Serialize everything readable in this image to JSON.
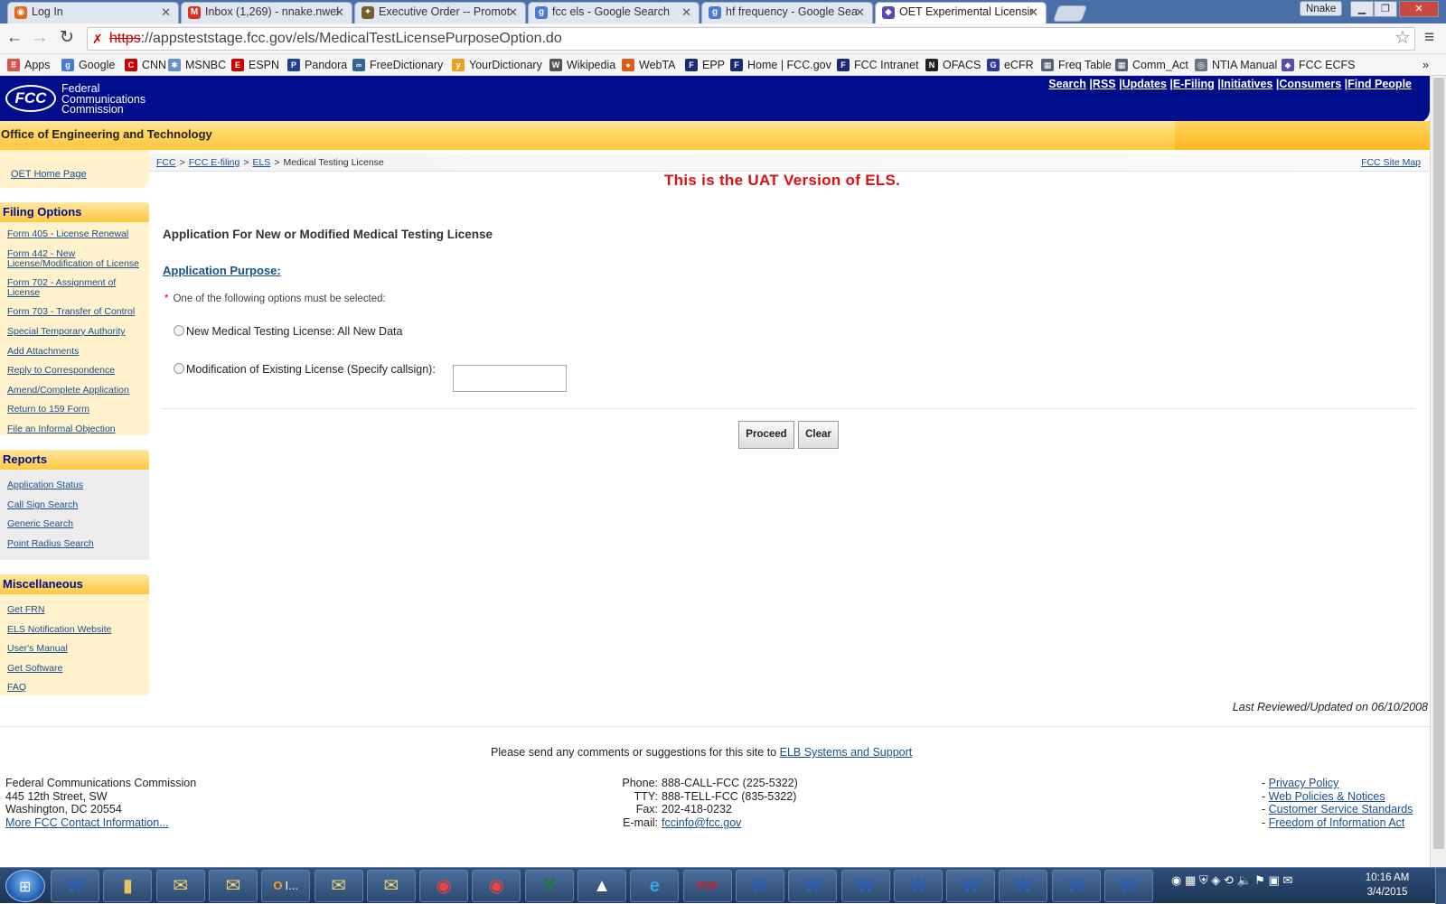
{
  "browser": {
    "tabs": [
      {
        "title": "Log In",
        "favicon": "firefox-icon",
        "color": "#e06a1a",
        "glyph": "◉"
      },
      {
        "title": "Inbox (1,269) - nnake.nwel",
        "favicon": "gmail-icon",
        "color": "#d93025",
        "glyph": "M"
      },
      {
        "title": "Executive Order -- Promot",
        "favicon": "whitehouse-seal-icon",
        "color": "#7a5c2e",
        "glyph": "✦"
      },
      {
        "title": "fcc els - Google Search",
        "favicon": "google-icon",
        "color": "#4a7bd8",
        "glyph": "g"
      },
      {
        "title": "hf frequency - Google Sea",
        "favicon": "google-icon",
        "color": "#4a7bd8",
        "glyph": "g"
      },
      {
        "title": "OET Experimental Licensir",
        "favicon": "fcc-diamond-icon",
        "color": "#5a4ab8",
        "glyph": "◆"
      }
    ],
    "profile_name": "Nnake",
    "url_scheme": "https",
    "url_rest": "://appsteststage.fcc.gov/els/MedicalTestLicensePurposeOption.do",
    "bookmarks": [
      {
        "label": "Apps",
        "icon": "apps-grid-icon",
        "color": "#d9534f",
        "glyph": "⠿"
      },
      {
        "label": "Google",
        "icon": "google-icon",
        "color": "#4a7bd8",
        "glyph": "g"
      },
      {
        "label": "CNN",
        "icon": "cnn-icon",
        "color": "#cc0000",
        "glyph": "C"
      },
      {
        "label": "MSNBC",
        "icon": "msnbc-icon",
        "color": "#6a8fd0",
        "glyph": "✱"
      },
      {
        "label": "ESPN",
        "icon": "espn-icon",
        "color": "#cc0000",
        "glyph": "E"
      },
      {
        "label": "Pandora",
        "icon": "pandora-icon",
        "color": "#224099",
        "glyph": "P"
      },
      {
        "label": "FreeDictionary",
        "icon": "freedictionary-icon",
        "color": "#336699",
        "glyph": "∞"
      },
      {
        "label": "YourDictionary",
        "icon": "yourdictionary-icon",
        "color": "#f0a020",
        "glyph": "y"
      },
      {
        "label": "Wikipedia",
        "icon": "wikipedia-icon",
        "color": "#555555",
        "glyph": "W"
      },
      {
        "label": "WebTA",
        "icon": "webta-icon",
        "color": "#e05a1a",
        "glyph": "●"
      },
      {
        "label": "EPP",
        "icon": "epp-icon",
        "color": "#1a2a7a",
        "glyph": "F"
      },
      {
        "label": "Home | FCC.gov",
        "icon": "fcc-icon",
        "color": "#1a2a7a",
        "glyph": "F"
      },
      {
        "label": "FCC Intranet",
        "icon": "fcc-icon",
        "color": "#1a2a7a",
        "glyph": "F"
      },
      {
        "label": "OFACS",
        "icon": "ofacs-icon",
        "color": "#222222",
        "glyph": "N"
      },
      {
        "label": "eCFR",
        "icon": "gpo-icon",
        "color": "#2a3aa0",
        "glyph": "G"
      },
      {
        "label": "Freq Table",
        "icon": "freq-table-icon",
        "color": "#556677",
        "glyph": "▦"
      },
      {
        "label": "Comm_Act",
        "icon": "comm-act-icon",
        "color": "#556677",
        "glyph": "▦"
      },
      {
        "label": "NTIA Manual",
        "icon": "ntia-icon",
        "color": "#667788",
        "glyph": "◎"
      },
      {
        "label": "FCC ECFS",
        "icon": "fcc-diamond-icon",
        "color": "#5a4ab8",
        "glyph": "◆"
      }
    ],
    "bookmarks_overflow": "»"
  },
  "site": {
    "logo_text": "FCC",
    "agency_name": [
      "Federal",
      "Communications",
      "Commission"
    ],
    "header_links": [
      "Search",
      "RSS",
      "Updates",
      "E-Filing",
      "Initiatives",
      "Consumers",
      "Find People"
    ],
    "office_title": "Office of Engineering and Technology",
    "oet_home_link": "OET Home Page",
    "site_map_link": "FCC Site Map",
    "breadcrumb": [
      {
        "label": "FCC",
        "link": true
      },
      {
        "label": "FCC E-filing",
        "link": true
      },
      {
        "label": "ELS",
        "link": true
      },
      {
        "label": "Medical Testing License",
        "link": false
      }
    ],
    "breadcrumb_sep": ">",
    "uat_notice": "This is the UAT Version of ELS."
  },
  "sidebar": {
    "filing_options_title": "Filing Options",
    "filing_options": [
      "Form 405 - License Renewal",
      "Form 442 - New License/Modification of License",
      "Form 702 - Assignment of License",
      "Form 703 - Transfer of Control",
      "Special Temporary Authority",
      "Add Attachments",
      "Reply to Correspondence",
      "Amend/Complete Application",
      "Return to 159 Form",
      "File an Informal Objection"
    ],
    "reports_title": "Reports",
    "reports": [
      "Application Status",
      "Call Sign Search",
      "Generic Search",
      "Point Radius Search"
    ],
    "misc_title": "Miscellaneous",
    "misc": [
      "Get FRN",
      "ELS Notification Website",
      "User's Manual",
      "Get Software",
      "FAQ"
    ]
  },
  "form": {
    "title": "Application For New or Modified Medical Testing License",
    "purpose_label": "Application Purpose:",
    "required_star": "*",
    "required_note": "One of the following options must be selected:",
    "option_new": "New Medical Testing License: All New Data",
    "option_new_selected": false,
    "option_modify": "Modification of Existing License (Specify callsign):",
    "option_modify_selected": false,
    "callsign_value": "",
    "proceed_label": "Proceed",
    "clear_label": "Clear"
  },
  "footer": {
    "last_reviewed": "Last Reviewed/Updated on 06/10/2008",
    "comments_text": "Please send any comments or suggestions for this site to",
    "comments_link": "ELB Systems and Support",
    "address": [
      "Federal Communications Commission",
      "445 12th Street, SW",
      "Washington, DC 20554"
    ],
    "more_contact": "More FCC Contact Information...",
    "contact_rows": [
      {
        "label": "Phone:",
        "value": "888-CALL-FCC (225-5322)"
      },
      {
        "label": "TTY:",
        "value": "888-TELL-FCC (835-5322)"
      },
      {
        "label": "Fax:",
        "value": "202-418-0232"
      },
      {
        "label": "E-mail:",
        "value": "fccinfo@fcc.gov"
      }
    ],
    "policy_links": [
      "Privacy Policy",
      "Web Policies & Notices",
      "Customer Service Standards",
      "Freedom of Information Act"
    ]
  },
  "taskbar": {
    "apps": [
      {
        "name": "word-icon",
        "glyph": "W",
        "color": "#2b5fb4"
      },
      {
        "name": "explorer-folder-icon",
        "glyph": "▮",
        "color": "#e8c25a"
      },
      {
        "name": "mail-icon",
        "glyph": "✉",
        "color": "#f2d36b"
      },
      {
        "name": "mail-icon",
        "glyph": "✉",
        "color": "#f2d36b"
      },
      {
        "name": "outlook-icon",
        "glyph": "O",
        "color": "#f0a020"
      },
      {
        "name": "mail-icon",
        "glyph": "✉",
        "color": "#f2d36b"
      },
      {
        "name": "mail-icon",
        "glyph": "✉",
        "color": "#f2d36b"
      },
      {
        "name": "chrome-icon",
        "glyph": "◉",
        "color": "#e8453c"
      },
      {
        "name": "chrome-icon",
        "glyph": "◉",
        "color": "#e8453c"
      },
      {
        "name": "excel-icon",
        "glyph": "X",
        "color": "#1e7a3c"
      },
      {
        "name": "prism-icon",
        "glyph": "▲",
        "color": "#ffffff"
      },
      {
        "name": "internet-explorer-icon",
        "glyph": "e",
        "color": "#3fa2e8"
      },
      {
        "name": "pdf-icon",
        "glyph": "PDF",
        "color": "#cc2222"
      },
      {
        "name": "word-icon",
        "glyph": "W",
        "color": "#2b5fb4"
      },
      {
        "name": "word-icon",
        "glyph": "W",
        "color": "#2b5fb4"
      },
      {
        "name": "word-icon",
        "glyph": "W",
        "color": "#2b5fb4"
      },
      {
        "name": "word-icon",
        "glyph": "W",
        "color": "#2b5fb4"
      },
      {
        "name": "word-icon",
        "glyph": "W",
        "color": "#2b5fb4"
      },
      {
        "name": "word-icon",
        "glyph": "W",
        "color": "#2b5fb4"
      },
      {
        "name": "word-icon",
        "glyph": "W",
        "color": "#2b5fb4"
      },
      {
        "name": "word-icon",
        "glyph": "W",
        "color": "#2b5fb4"
      }
    ],
    "outlook_label": "I...",
    "clock_time": "10:16 AM",
    "clock_date": "3/4/2015"
  },
  "colors": {
    "fcc_blue": "#000e8c",
    "gold": "#ffc840",
    "link": "#1a4f8b",
    "uat_red": "#e01010"
  }
}
